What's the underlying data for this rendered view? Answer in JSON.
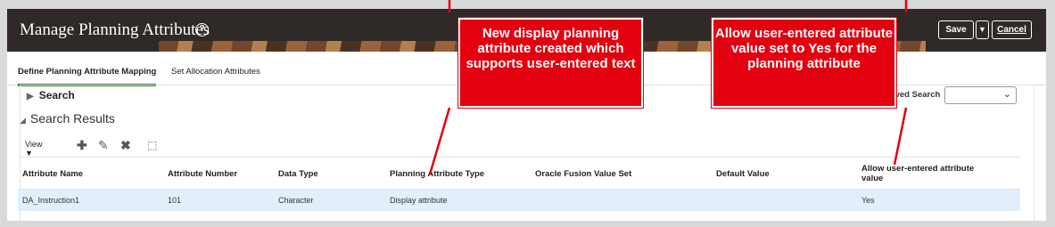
{
  "header": {
    "title": "Manage Planning Attributes",
    "help_glyph": "?",
    "save_label": "Save",
    "save_menu_glyph": "▼",
    "cancel_label": "Cancel"
  },
  "tabs": [
    {
      "label": "Define Planning Attribute Mapping",
      "active": true
    },
    {
      "label": "Set Allocation Attributes",
      "active": false
    }
  ],
  "search": {
    "label": "Search",
    "saved_search_label": "Saved Search",
    "saved_search_value": ""
  },
  "results": {
    "title": "Search Results",
    "view_label": "View",
    "icons": [
      "add-icon",
      "edit-icon",
      "delete-icon",
      "detach-icon"
    ],
    "columns": [
      "Attribute Name",
      "Attribute Number",
      "Data Type",
      "Planning Attribute Type",
      "Oracle Fusion Value Set",
      "Default Value",
      "Allow user-entered attribute value"
    ],
    "rows": [
      {
        "attribute_name": "DA_Instruction1",
        "attribute_number": "101",
        "data_type": "Character",
        "planning_attribute_type": "Display attribute",
        "oracle_fusion_value_set": "",
        "default_value": "",
        "allow_user_entered": "Yes"
      }
    ]
  },
  "callouts": {
    "left": "New display planning attribute created which supports user-entered text",
    "right": "Allow user-entered attribute value set to Yes for the planning attribute"
  },
  "colors": {
    "callout": "#e3000f",
    "header_bg": "#2f2a27",
    "selected_row": "#e2effb",
    "active_tab_underline": "#3d7a3d"
  }
}
